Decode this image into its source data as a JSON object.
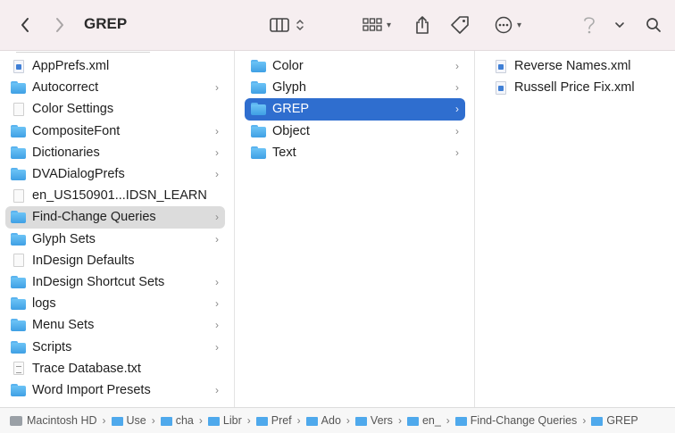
{
  "window": {
    "title": "GREP"
  },
  "toolbar": {
    "back_icon": "chevron-left-icon",
    "forward_icon": "chevron-right-icon",
    "view_icon": "column-view-icon",
    "group_icon": "grid-icon",
    "share_icon": "share-icon",
    "tag_icon": "tag-icon",
    "more_icon": "ellipsis-icon",
    "help_icon": "question-mark-icon",
    "search_icon": "search-icon"
  },
  "column1": {
    "items": [
      {
        "name": "AppPrefs.xml",
        "kind": "xml"
      },
      {
        "name": "Autocorrect",
        "kind": "folder"
      },
      {
        "name": "Color Settings",
        "kind": "doc"
      },
      {
        "name": "CompositeFont",
        "kind": "folder"
      },
      {
        "name": "Dictionaries",
        "kind": "folder"
      },
      {
        "name": "DVADialogPrefs",
        "kind": "folder"
      },
      {
        "name": "en_US150901...IDSN_LEARN",
        "kind": "doc"
      },
      {
        "name": "Find-Change Queries",
        "kind": "folder",
        "selected": true
      },
      {
        "name": "Glyph Sets",
        "kind": "folder"
      },
      {
        "name": "InDesign Defaults",
        "kind": "doc"
      },
      {
        "name": "InDesign Shortcut Sets",
        "kind": "folder"
      },
      {
        "name": "logs",
        "kind": "folder"
      },
      {
        "name": "Menu Sets",
        "kind": "folder"
      },
      {
        "name": "Scripts",
        "kind": "folder"
      },
      {
        "name": "Trace Database.txt",
        "kind": "txt"
      },
      {
        "name": "Word Import Presets",
        "kind": "folder"
      }
    ]
  },
  "column2": {
    "items": [
      {
        "name": "Color"
      },
      {
        "name": "Glyph"
      },
      {
        "name": "GREP",
        "selected": true
      },
      {
        "name": "Object"
      },
      {
        "name": "Text"
      }
    ]
  },
  "column3": {
    "items": [
      {
        "name": "Reverse Names.xml"
      },
      {
        "name": "Russell Price Fix.xml"
      }
    ]
  },
  "path_bar": {
    "crumbs": [
      "Macintosh HD",
      "Use",
      "cha",
      "Libr",
      "Pref",
      "Ado",
      "Vers",
      "en_",
      "Find-Change Queries",
      "GREP"
    ]
  },
  "colors": {
    "selection_active": "#2f6ecf",
    "selection_inactive": "#dcdcdc",
    "folder": "#4fa9ec"
  }
}
